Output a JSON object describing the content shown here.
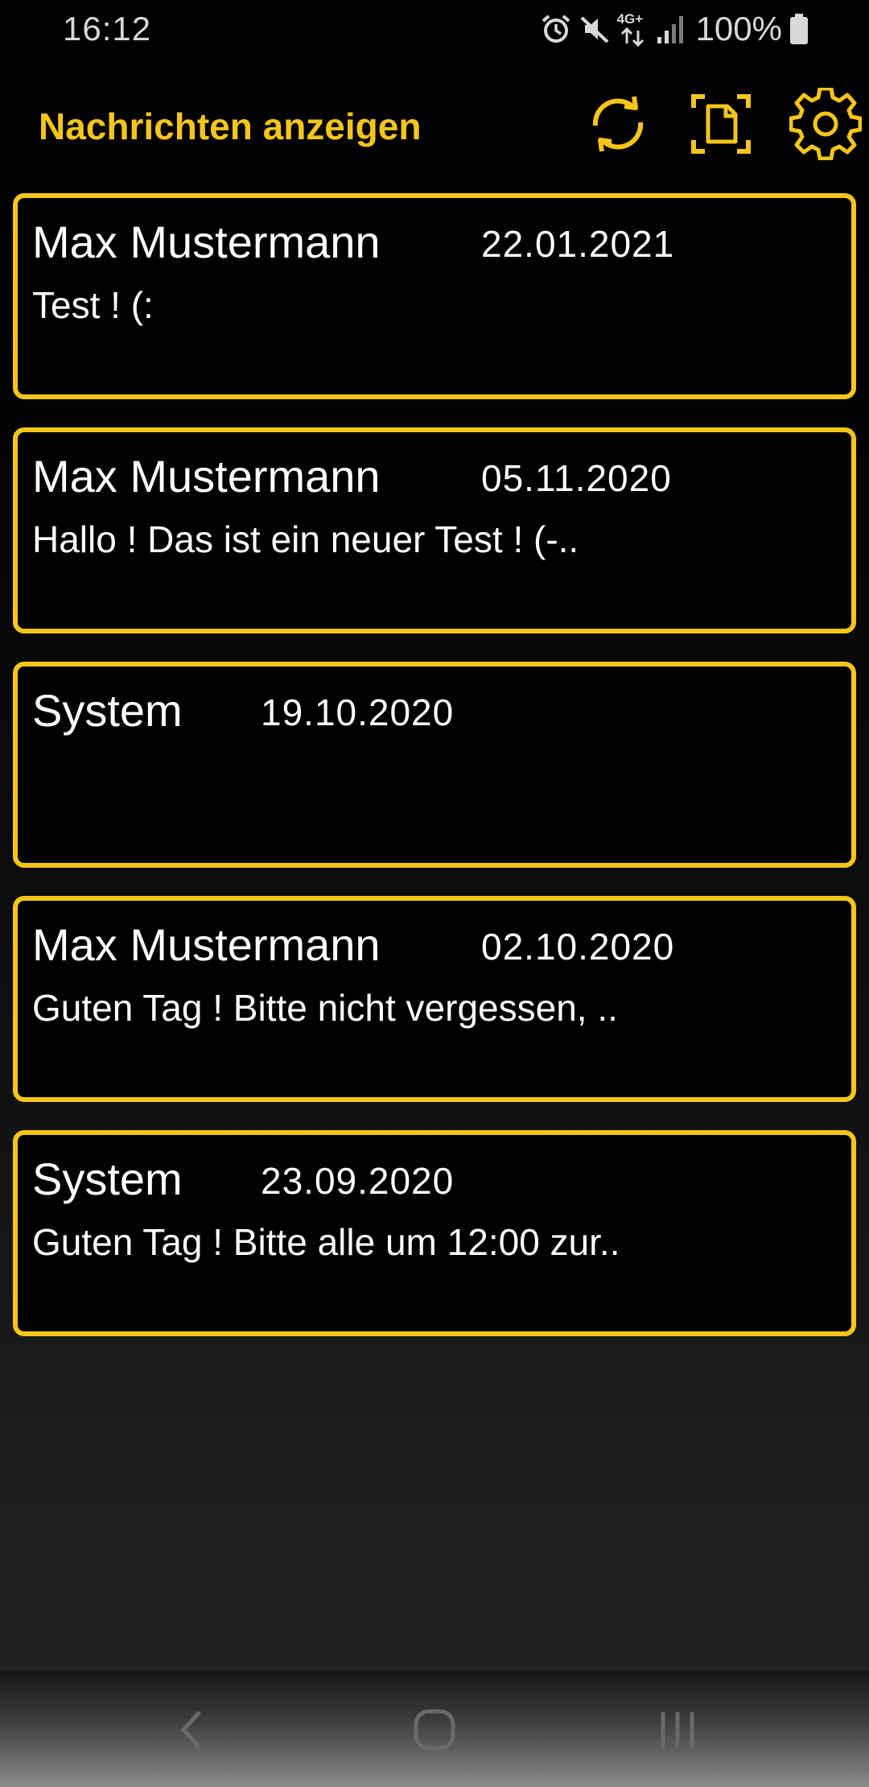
{
  "status_bar": {
    "time": "16:12",
    "network_label": "4G+",
    "battery": "100%",
    "icons": [
      "alarm-icon",
      "mute-icon",
      "network-4g-icon",
      "signal-icon",
      "battery-icon"
    ]
  },
  "app_bar": {
    "title": "Nachrichten anzeigen",
    "actions": [
      "refresh-icon",
      "document-icon",
      "settings-gear-icon"
    ]
  },
  "messages": [
    {
      "sender": "Max Mustermann",
      "date": "22.01.2021",
      "preview": "Test ! (:"
    },
    {
      "sender": "Max Mustermann",
      "date": "05.11.2020",
      "preview": "Hallo ! Das ist ein neuer Test ! (-.."
    },
    {
      "sender": "System",
      "date": "19.10.2020",
      "preview": ""
    },
    {
      "sender": "Max Mustermann",
      "date": "02.10.2020",
      "preview": "Guten Tag ! Bitte nicht vergessen, .."
    },
    {
      "sender": "System",
      "date": "23.09.2020",
      "preview": "Guten Tag ! Bitte alle um 12:00 zur.."
    }
  ],
  "nav_bar": {
    "buttons": [
      "back-icon",
      "home-icon",
      "recents-icon"
    ]
  },
  "colors": {
    "accent": "#f5c518",
    "background": "#000000",
    "text": "#ffffff"
  }
}
